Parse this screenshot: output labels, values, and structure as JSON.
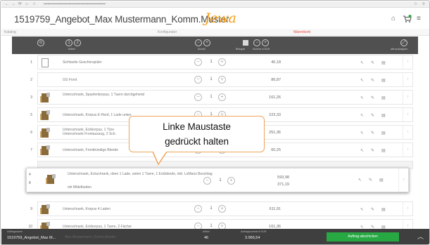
{
  "browser": {
    "nav_buttons": [
      "←",
      "→",
      "⟳",
      "⌂",
      "☆"
    ],
    "url": "▪▪▪▪▪▪▪▪▪▪▪▪▪▪▪▪▪▪▪▪▪▪▪▪▪▪▪▪▪▪▪▪▪▪▪▪▪▪▪▪▪▪▪▪▪▪▪",
    "right_icons": [
      "☆",
      "≡"
    ]
  },
  "header": {
    "title": "1519759_Angebot_Max Mustermann_Komm.Muster",
    "logo": "Jewa",
    "icons": {
      "home": "⌂",
      "cart": "🛒",
      "menu": "≡"
    },
    "cart_badge_color": "#27a843"
  },
  "steps": [
    "Katalog",
    "Konfigurator",
    "Warenkorb"
  ],
  "toolbar": {
    "labels": [
      "",
      "Artikel",
      "Anzahl",
      "Belegart",
      "Summe in EUR",
      "alle ausklappen"
    ]
  },
  "rows": [
    {
      "num": "1",
      "desc": "Sichtseite Geschirrspüler",
      "qty": "1",
      "price": "40,18",
      "thumb": "outline"
    },
    {
      "num": "2",
      "desc": "GS Front",
      "qty": "1",
      "price": "86,87",
      "thumb": "none"
    },
    {
      "num": "3",
      "desc": "Unterschrank, Spuelenkorpus, 1 Tuere durchgehend",
      "qty": "1",
      "price": "161,26",
      "thumb": "cabinet"
    },
    {
      "num": "5",
      "desc": "Unterschrank, Korpus E-Herd, 1 Lade unten",
      "qty": "1",
      "price": "223,33",
      "thumb": "cabinet"
    },
    {
      "num": "6",
      "desc": "Unterschrank, Eckkorpus, 1 Türe\nUnterschrank Frontauszug, 2 Sch.",
      "qty": "1",
      "price": "251,36",
      "thumb": "cabinet"
    },
    {
      "num": "7",
      "desc": "Unterschrank, Frontbündige Blende",
      "qty": "1",
      "price": "60,25",
      "thumb": "cabinet"
    },
    {
      "num": "9",
      "desc": "Unterschrank, Korpus 4 Laden",
      "qty": "1",
      "price": "611,91",
      "thumb": "cabinet"
    },
    {
      "num": "10",
      "desc": "Unterschrank, Eckkorpus, 1 Tuere, 2 Fächer",
      "qty": "1",
      "price": "161,36",
      "thumb": "cabinet"
    }
  ],
  "dragged": {
    "num": "4",
    "num_below": "8",
    "desc": "Unterschrank, Eckschrank, oben 1 Lade, unten 1 Tuere, 1 Eckblende, inkl. LeMans Beschlag",
    "sub": "mit Mittelboden",
    "qty": "1",
    "price": "593,98",
    "price_below": "371,19"
  },
  "callout": {
    "line1": "Linke Maustaste",
    "line2": "gedrückt halten",
    "border_color": "#f0a35a"
  },
  "footer": {
    "order_label": "Auftragsname",
    "order_value": "1519759_Angebot_Max M...",
    "faint_text": "Max Mustermann_Komm.Muster",
    "count_label": "Artikel",
    "count_value": "46",
    "sum_label": "Auftragssumme in EUR",
    "sum_value": "3.966,54",
    "submit": "Auftrag abschicken",
    "submit_color": "#27a843"
  }
}
